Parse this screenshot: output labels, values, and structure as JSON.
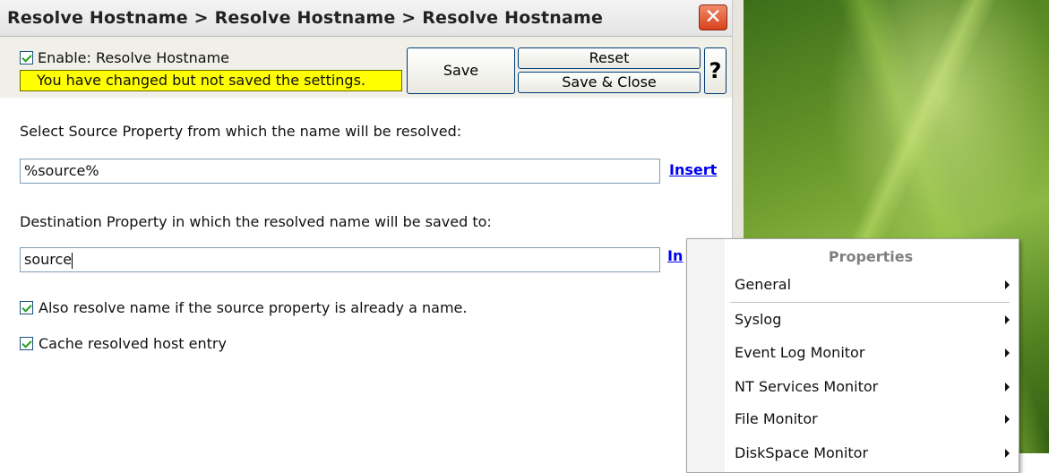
{
  "window": {
    "title": "Resolve Hostname > Resolve Hostname > Resolve Hostname",
    "close_label": "✕"
  },
  "header": {
    "enable_label": "Enable: Resolve Hostname",
    "enable_checked": true,
    "warning": "You have changed but not saved the settings.",
    "save_label": "Save",
    "reset_label": "Reset",
    "save_close_label": "Save & Close",
    "help_label": "?"
  },
  "form": {
    "source_label": "Select Source Property from which the name will be resolved:",
    "source_value": "%source%",
    "source_insert": "Insert",
    "dest_label": "Destination Property in which the resolved name will be saved to:",
    "dest_value": "source",
    "dest_insert_partial": "In",
    "option_also_resolve": "Also resolve name if the source property is already a name.",
    "option_cache": "Cache resolved host entry"
  },
  "context_menu": {
    "header": "Properties",
    "items": [
      {
        "label": "General"
      },
      {
        "label": "Syslog"
      },
      {
        "label": "Event Log Monitor"
      },
      {
        "label": "NT Services Monitor"
      },
      {
        "label": "File Monitor"
      },
      {
        "label": "DiskSpace Monitor"
      }
    ]
  },
  "colors": {
    "warning_bg": "#ffff00",
    "link": "#0000ee",
    "close_button": "#d9411d"
  }
}
